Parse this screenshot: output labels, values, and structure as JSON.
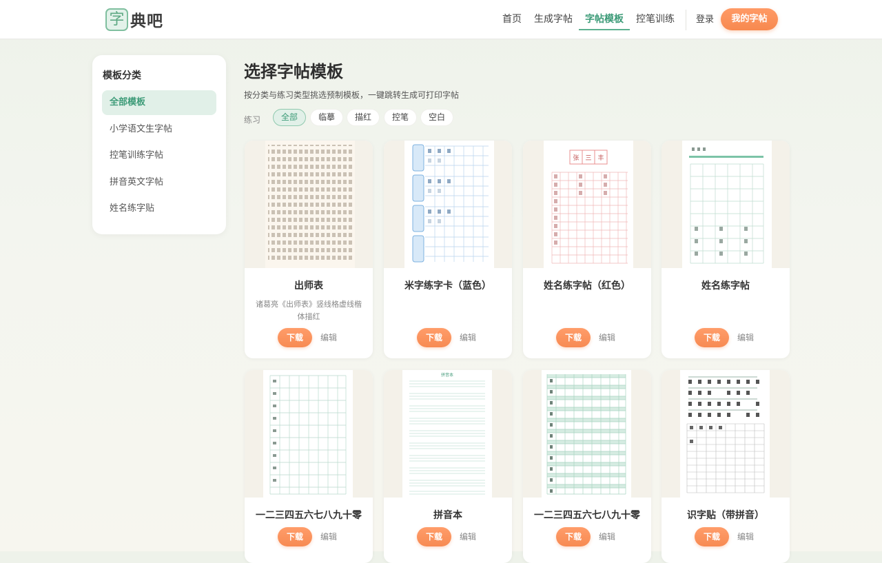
{
  "header": {
    "logo_mark": "字",
    "logo_text": "典吧",
    "nav": [
      {
        "label": "首页",
        "active": false
      },
      {
        "label": "生成字帖",
        "active": false
      },
      {
        "label": "字帖模板",
        "active": true
      },
      {
        "label": "控笔训练",
        "active": false
      }
    ],
    "login": "登录",
    "my_copybook": "我的字帖"
  },
  "sidebar": {
    "title": "模板分类",
    "items": [
      {
        "label": "全部模板",
        "active": true
      },
      {
        "label": "小学语文生字帖",
        "active": false
      },
      {
        "label": "控笔训练字帖",
        "active": false
      },
      {
        "label": "拼音英文字帖",
        "active": false
      },
      {
        "label": "姓名练字贴",
        "active": false
      }
    ]
  },
  "main": {
    "title": "选择字帖模板",
    "subtitle": "按分类与练习类型挑选预制模板，一键跳转生成可打印字帖",
    "filter_label": "练习",
    "filters": [
      {
        "label": "全部",
        "active": true
      },
      {
        "label": "临摹",
        "active": false
      },
      {
        "label": "描红",
        "active": false
      },
      {
        "label": "控笔",
        "active": false
      },
      {
        "label": "空白",
        "active": false
      }
    ]
  },
  "cards": [
    {
      "title": "出师表",
      "desc": "诸葛亮《出师表》竖线格虚线楷体描红",
      "download": "下载",
      "edit": "编辑",
      "style": "text"
    },
    {
      "title": "米字练字卡（蓝色）",
      "desc": "",
      "download": "下载",
      "edit": "编辑",
      "style": "blue"
    },
    {
      "title": "姓名练字帖（红色）",
      "desc": "",
      "download": "下载",
      "edit": "编辑",
      "style": "red"
    },
    {
      "title": "姓名练字帖",
      "desc": "",
      "download": "下载",
      "edit": "编辑",
      "style": "green"
    },
    {
      "title": "一二三四五六七八九十零",
      "desc": "",
      "download": "下载",
      "edit": "编辑",
      "style": "grid"
    },
    {
      "title": "拼音本",
      "desc": "",
      "download": "下载",
      "edit": "编辑",
      "style": "lines"
    },
    {
      "title": "一二三四五六七八九十零",
      "desc": "",
      "download": "下载",
      "edit": "编辑",
      "style": "pinyin-grid"
    },
    {
      "title": "识字贴（带拼音）",
      "desc": "",
      "download": "下载",
      "edit": "编辑",
      "style": "mixed"
    }
  ],
  "preview_text": {
    "red_name": [
      "张",
      "三",
      "丰"
    ],
    "lines_title": "拼音本"
  }
}
